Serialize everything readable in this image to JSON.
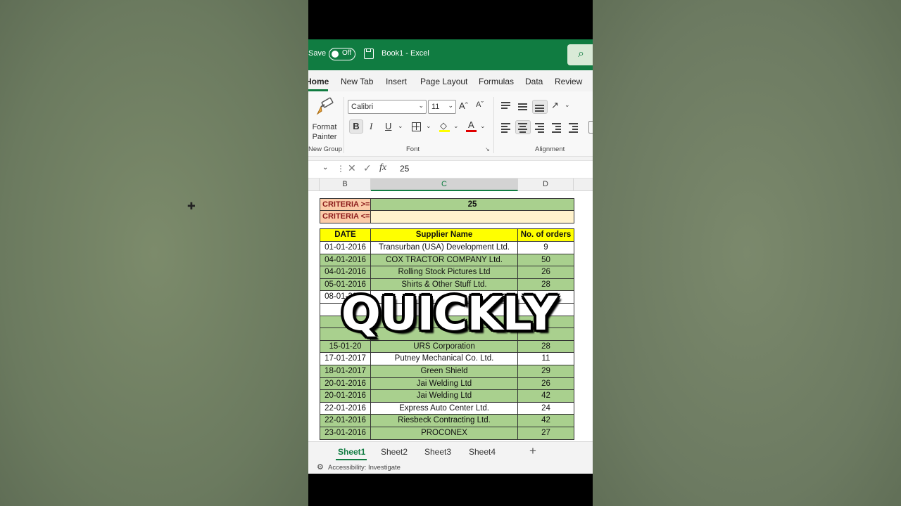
{
  "titlebar": {
    "autosave_label": "Save",
    "toggle_state": "Off",
    "document_title": "Book1  -  Excel",
    "search_icon": "search-icon",
    "accent_color": "#107c41"
  },
  "tabs": [
    "Home",
    "New Tab",
    "Insert",
    "Page Layout",
    "Formulas",
    "Data",
    "Review"
  ],
  "ribbon": {
    "format_painter_label": "Format Painter",
    "new_group_label": "New Group",
    "font_group_label": "Font",
    "alignment_group_label": "Alignment",
    "font_name": "Calibri",
    "font_size": "11",
    "grow_font": "Aˆ",
    "shrink_font": "Aˇ",
    "bold": "B",
    "italic": "I",
    "underline": "U",
    "font_color_letter": "A"
  },
  "formula_bar": {
    "fx": "fx",
    "value": "25"
  },
  "columns": [
    "B",
    "C",
    "D"
  ],
  "criteria": {
    "ge_label": "CRITERIA >=",
    "ge_value": "25",
    "le_label": "CRITERIA <=",
    "le_value": ""
  },
  "table": {
    "headers": [
      "DATE",
      "Supplier Name",
      "No. of orders"
    ],
    "rows": [
      {
        "date": "01-01-2016",
        "supplier": "Transurban (USA) Development Ltd.",
        "orders": "9"
      },
      {
        "date": "04-01-2016",
        "supplier": "COX TRACTOR COMPANY Ltd.",
        "orders": "50"
      },
      {
        "date": "04-01-2016",
        "supplier": "Rolling Stock Pictures Ltd",
        "orders": "26"
      },
      {
        "date": "05-01-2016",
        "supplier": "Shirts & Other Stuff Ltd.",
        "orders": "28"
      },
      {
        "date": "08-01-2017",
        "supplier": "",
        "orders": ""
      },
      {
        "date": "",
        "supplier": "",
        "orders": ""
      },
      {
        "date": "",
        "supplier": "",
        "orders": ""
      },
      {
        "date": "",
        "supplier": "",
        "orders": ""
      },
      {
        "date": "15-01-20",
        "supplier": "URS Corporation",
        "orders": "28"
      },
      {
        "date": "17-01-2017",
        "supplier": "Putney Mechanical Co. Ltd.",
        "orders": "11"
      },
      {
        "date": "18-01-2017",
        "supplier": "Green Shield",
        "orders": "29"
      },
      {
        "date": "20-01-2016",
        "supplier": "Jai Welding Ltd",
        "orders": "26"
      },
      {
        "date": "20-01-2016",
        "supplier": "Jai Welding Ltd",
        "orders": "42"
      },
      {
        "date": "22-01-2016",
        "supplier": "Express Auto Center Ltd.",
        "orders": "24"
      },
      {
        "date": "22-01-2016",
        "supplier": "Riesbeck Contracting Ltd.",
        "orders": "42"
      },
      {
        "date": "23-01-2016",
        "supplier": "PROCONEX",
        "orders": "27"
      }
    ]
  },
  "overlay_caption": "QUICKLY",
  "sheets": [
    "Sheet1",
    "Sheet2",
    "Sheet3",
    "Sheet4"
  ],
  "add_sheet": "+",
  "status": {
    "accessibility": "Accessibility: Investigate"
  }
}
